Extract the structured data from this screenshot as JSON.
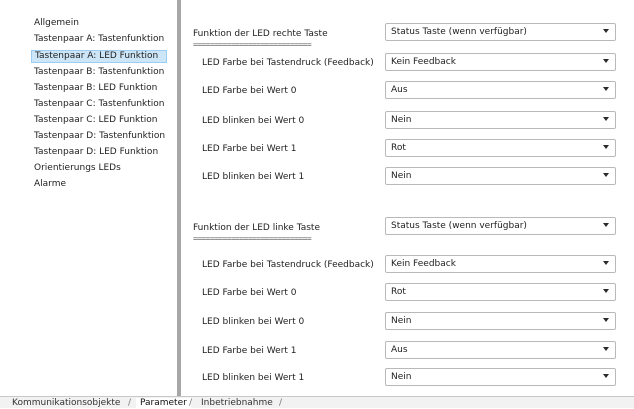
{
  "sidebar": {
    "items": [
      {
        "label": "Allgemein"
      },
      {
        "label": "Tastenpaar A: Tastenfunktion"
      },
      {
        "label": "Tastenpaar A: LED Funktion",
        "selected": true
      },
      {
        "label": "Tastenpaar B: Tastenfunktion"
      },
      {
        "label": "Tastenpaar B: LED Funktion"
      },
      {
        "label": "Tastenpaar C: Tastenfunktion"
      },
      {
        "label": "Tastenpaar C: LED Funktion"
      },
      {
        "label": "Tastenpaar D: Tastenfunktion"
      },
      {
        "label": "Tastenpaar D: LED Funktion"
      },
      {
        "label": "Orientierungs LEDs"
      },
      {
        "label": "Alarme"
      }
    ]
  },
  "groups": [
    {
      "title": "Funktion der LED rechte Taste",
      "separator": "============================",
      "function_value": "Status Taste (wenn verfügbar)",
      "params": [
        {
          "label": "LED Farbe bei Tastendruck (Feedback)",
          "value": "Kein Feedback"
        },
        {
          "label": "LED Farbe bei Wert 0",
          "value": "Aus"
        },
        {
          "label": "LED blinken bei Wert 0",
          "value": "Nein"
        },
        {
          "label": "LED Farbe bei Wert 1",
          "value": "Rot"
        },
        {
          "label": "LED blinken bei Wert 1",
          "value": "Nein"
        }
      ]
    },
    {
      "title": "Funktion der LED linke Taste",
      "separator": "============================",
      "function_value": "Status Taste (wenn verfügbar)",
      "params": [
        {
          "label": "LED Farbe bei Tastendruck (Feedback)",
          "value": "Kein Feedback"
        },
        {
          "label": "LED Farbe bei Wert 0",
          "value": "Rot"
        },
        {
          "label": "LED blinken bei Wert 0",
          "value": "Nein"
        },
        {
          "label": "LED Farbe bei Wert 1",
          "value": "Aus"
        },
        {
          "label": "LED blinken bei Wert 1",
          "value": "Nein"
        }
      ]
    }
  ],
  "tabs": [
    {
      "label": "Kommunikationsobjekte"
    },
    {
      "label": "Parameter",
      "active": true
    },
    {
      "label": "Inbetriebnahme"
    }
  ],
  "tab_separator": "/"
}
